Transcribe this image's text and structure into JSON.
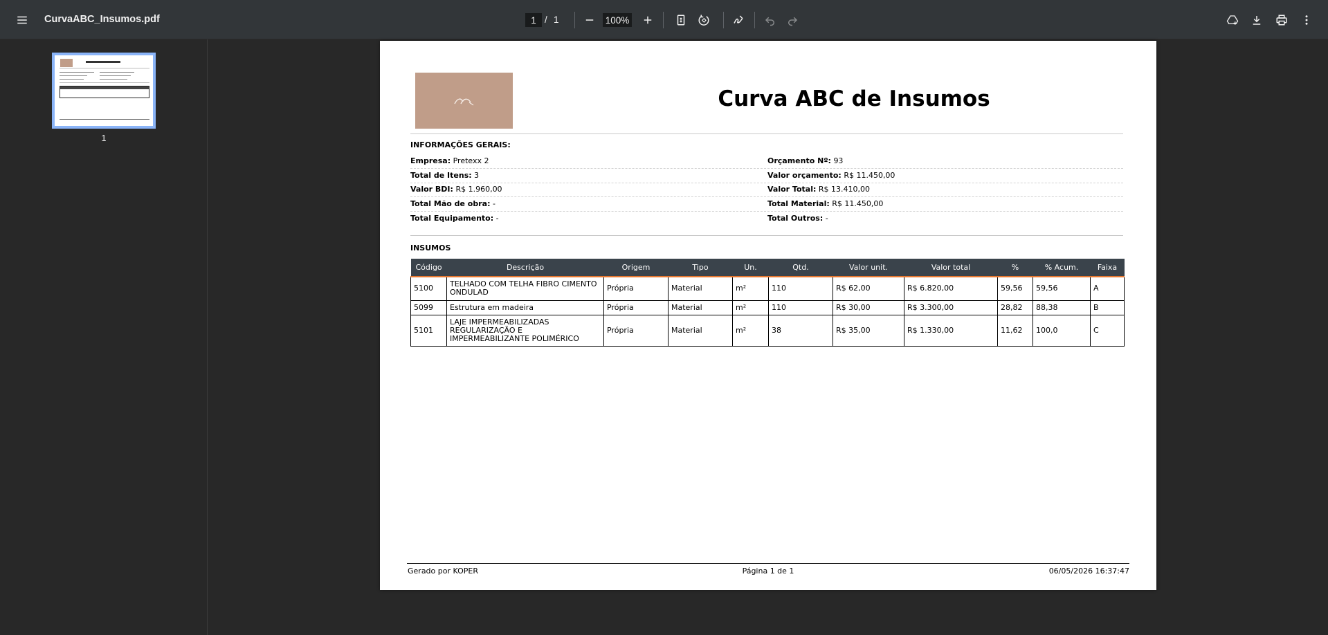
{
  "toolbar": {
    "file_name": "CurvaABC_Insumos.pdf",
    "current_page": "1",
    "page_separator": "/",
    "total_pages": "1",
    "zoom": "100%"
  },
  "sidebar": {
    "thumbnail_label": "1"
  },
  "document": {
    "title": "Curva ABC de Insumos",
    "general_section_title": "INFORMAÇÕES GERAIS:",
    "info": {
      "empresa": {
        "label": "Empresa:",
        "value": "Pretexx 2"
      },
      "orcamento": {
        "label": "Orçamento Nº:",
        "value": "93"
      },
      "total_itens": {
        "label": "Total de Itens:",
        "value": "3"
      },
      "valor_orcamento": {
        "label": "Valor orçamento:",
        "value": "R$ 11.450,00"
      },
      "valor_bdi": {
        "label": "Valor BDI:",
        "value": "R$ 1.960,00"
      },
      "valor_total": {
        "label": "Valor Total:",
        "value": "R$ 13.410,00"
      },
      "total_mao_obra": {
        "label": "Total Mão de obra:",
        "value": "-"
      },
      "total_material": {
        "label": "Total Material:",
        "value": "R$ 11.450,00"
      },
      "total_equipamento": {
        "label": "Total Equipamento:",
        "value": "-"
      },
      "total_outros": {
        "label": "Total Outros:",
        "value": "-"
      }
    },
    "insumos_section_title": "INSUMOS",
    "table": {
      "headers": [
        "Código",
        "Descrição",
        "Origem",
        "Tipo",
        "Un.",
        "Qtd.",
        "Valor unit.",
        "Valor total",
        "%",
        "% Acum.",
        "Faixa"
      ],
      "rows": [
        [
          "5100",
          "TELHADO COM TELHA FIBRO CIMENTO ONDULAD",
          "Própria",
          "Material",
          "m²",
          "110",
          "R$ 62,00",
          "R$ 6.820,00",
          "59,56",
          "59,56",
          "A"
        ],
        [
          "5099",
          "Estrutura em madeira",
          "Própria",
          "Material",
          "m²",
          "110",
          "R$ 30,00",
          "R$ 3.300,00",
          "28,82",
          "88,38",
          "B"
        ],
        [
          "5101",
          "LAJE IMPERMEABILIZADAS REGULARIZAÇÃO E IMPERMEABILIZANTE POLIMÉRICO",
          "Própria",
          "Material",
          "m²",
          "38",
          "R$ 35,00",
          "R$ 1.330,00",
          "11,62",
          "100,0",
          "C"
        ]
      ]
    },
    "footer": {
      "generated_by": "Gerado por KOPER",
      "page_info": "Página 1 de 1",
      "timestamp": "06/05/2026 16:37:47"
    }
  },
  "colors": {
    "toolbar_bg": "#323639",
    "viewer_bg": "#282828",
    "table_header_bg": "#3a434b",
    "table_header_accent": "#e8772e",
    "logo_bg": "#c09d89",
    "thumb_selected": "#8ab4f8"
  }
}
